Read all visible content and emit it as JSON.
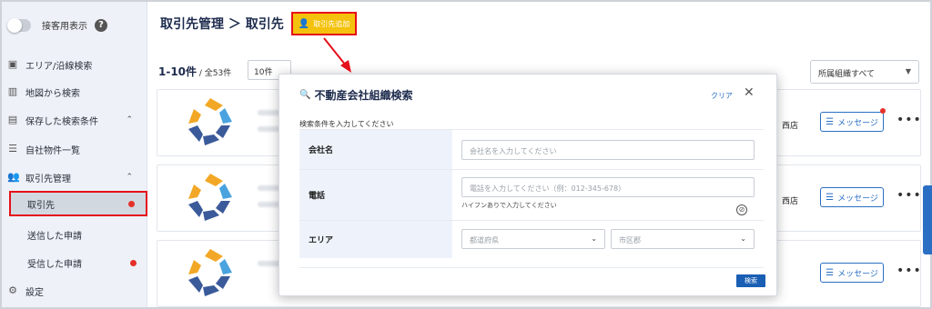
{
  "sidebar": {
    "toggle_label": "接客用表示",
    "help_icon": "?",
    "items": [
      {
        "label": "エリア/沿線検索",
        "icon": "train-icon"
      },
      {
        "label": "地図から検索",
        "icon": "map-icon"
      },
      {
        "label": "保存した検索条件",
        "icon": "saved-search-icon",
        "chevron": "⌃"
      },
      {
        "label": "自社物件一覧",
        "icon": "list-icon"
      },
      {
        "label": "取引先管理",
        "icon": "people-icon",
        "chevron": "⌃"
      }
    ],
    "sub_items": [
      {
        "label": "取引先",
        "active": true,
        "dot": true
      },
      {
        "label": "送信した申請",
        "active": false,
        "dot": false
      },
      {
        "label": "受信した申請",
        "active": false,
        "dot": true
      }
    ],
    "settings_label": "設定"
  },
  "header": {
    "title": "取引先管理 ＞ 取引先",
    "add_button": "取引先追加"
  },
  "list": {
    "count": "1-10件",
    "total": " / 全53件",
    "per_page": "10件",
    "org_filter": "所属組織すべて",
    "branch_label": "西店",
    "message_label": "メッセージ",
    "more_icon": "•••"
  },
  "modal": {
    "title": "不動産会社組織検索",
    "clear": "クリア",
    "close": "✕",
    "hint": "検索条件を入力してください",
    "company_label": "会社名",
    "company_placeholder": "会社名を入力してください",
    "phone_label": "電話",
    "phone_placeholder": "電話を入力してください（例：012-345-678）",
    "phone_note": "ハイフンありで入力してください",
    "area_label": "エリア",
    "prefecture_placeholder": "都道府県",
    "city_placeholder": "市区郡",
    "search_button": "検索"
  },
  "colors": {
    "accent": "#2a6fc4",
    "add_button": "#f4c20d",
    "highlight": "#e5101b",
    "logo_blue": "#3a5a9a",
    "logo_light_blue": "#4aa3df",
    "logo_yellow": "#f2a826"
  }
}
